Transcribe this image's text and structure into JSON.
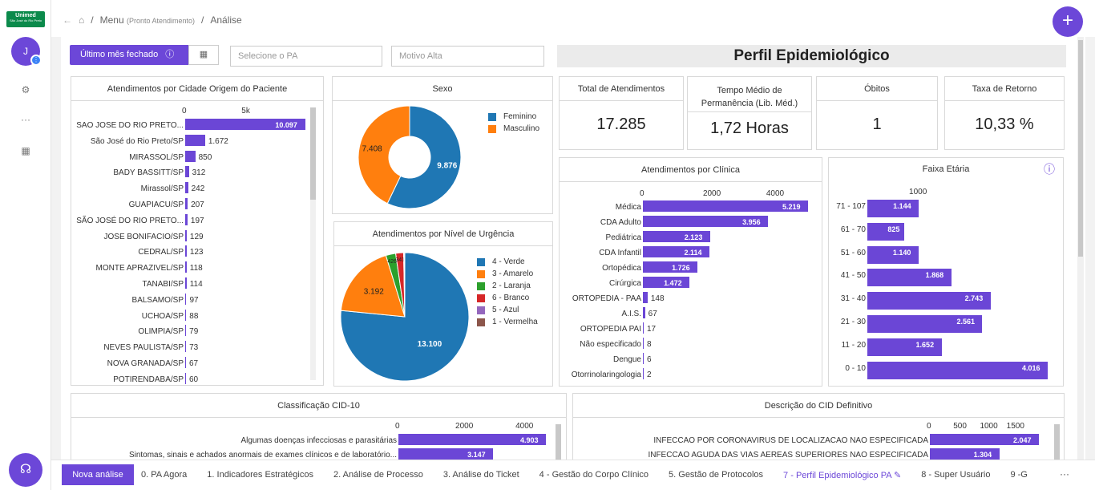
{
  "brand": {
    "logo_text": "Unimed",
    "logo_sub": "São José do Rio Preto",
    "color": "#6c47d8"
  },
  "user": {
    "initial": "J"
  },
  "breadcrumb": {
    "menu": "Menu",
    "menu_sub": "(Pronto Atendimento)",
    "sep": "/",
    "page": "Análise"
  },
  "filters": {
    "period": "Último mês fechado",
    "pa_placeholder": "Selecione o PA",
    "motivo_placeholder": "Motivo Alta"
  },
  "dashboard_title": "Perfil Epidemiológico",
  "kpis": [
    {
      "title": "Total de Atendimentos",
      "value": "17.285"
    },
    {
      "title": "Tempo Médio de Permanência (Lib. Méd.)",
      "value": "1,72 Horas"
    },
    {
      "title": "Óbitos",
      "value": "1"
    },
    {
      "title": "Taxa de Retorno",
      "value": "10,33 %"
    }
  ],
  "cards": {
    "cidade": "Atendimentos por Cidade Origem do Paciente",
    "sexo": "Sexo",
    "urgencia": "Atendimentos por Nível de Urgência",
    "clinica": "Atendimentos por Clínica",
    "faixa": "Faixa Etária",
    "cid10": "Classificação CID-10",
    "cid_def": "Descrição do CID Definitivo"
  },
  "chart_data": [
    {
      "type": "bar",
      "orientation": "horizontal",
      "title": "Atendimentos por Cidade Origem do Paciente",
      "ticks": [
        "0",
        "5k"
      ],
      "xlim": [
        0,
        10097
      ],
      "categories": [
        "SAO JOSE DO RIO PRETO...",
        "São José do Rio Preto/SP",
        "MIRASSOL/SP",
        "BADY BASSITT/SP",
        "Mirassol/SP",
        "GUAPIACU/SP",
        "SÃO JOSÉ DO RIO PRETO...",
        "JOSE BONIFACIO/SP",
        "CEDRAL/SP",
        "MONTE APRAZIVEL/SP",
        "TANABI/SP",
        "BALSAMO/SP",
        "UCHOA/SP",
        "OLIMPIA/SP",
        "NEVES PAULISTA/SP",
        "NOVA GRANADA/SP",
        "POTIRENDABA/SP"
      ],
      "values": [
        10097,
        1672,
        850,
        312,
        242,
        207,
        197,
        129,
        123,
        118,
        114,
        97,
        88,
        79,
        73,
        67,
        60
      ],
      "labels": [
        "10.097",
        "1.672",
        "850",
        "312",
        "242",
        "207",
        "197",
        "129",
        "123",
        "118",
        "114",
        "97",
        "88",
        "79",
        "73",
        "67",
        "60"
      ]
    },
    {
      "type": "pie",
      "title": "Sexo",
      "donut": true,
      "categories": [
        "Feminino",
        "Masculino"
      ],
      "values": [
        9876,
        7408
      ],
      "labels": [
        "9.876",
        "7.408"
      ],
      "colors": [
        "#1f77b4",
        "#ff7f0e"
      ]
    },
    {
      "type": "pie",
      "title": "Atendimentos por Nível de Urgência",
      "categories": [
        "4 - Verde",
        "3 - Amarelo",
        "2 - Laranja",
        "6 - Branco",
        "5 - Azul",
        "1 - Vermelha"
      ],
      "values": [
        13100,
        3192,
        426,
        341,
        40,
        10
      ],
      "labels": [
        "13.100",
        "3.192",
        "426",
        "341",
        "",
        ""
      ],
      "colors": [
        "#1f77b4",
        "#ff7f0e",
        "#2ca02c",
        "#d62728",
        "#9467bd",
        "#8c564b"
      ]
    },
    {
      "type": "bar",
      "orientation": "horizontal",
      "title": "Atendimentos por Clínica",
      "ticks": [
        "0",
        "2000",
        "4000"
      ],
      "xlim": [
        0,
        5219
      ],
      "categories": [
        "Médica",
        "CDA Adulto",
        "Pediátrica",
        "CDA Infantil",
        "Ortopédica",
        "Cirúrgica",
        "ORTOPEDIA - PAA",
        "A.I.S.",
        "ORTOPEDIA PAI",
        "Não especificado",
        "Dengue",
        "Otorrinolaringologia"
      ],
      "values": [
        5219,
        3956,
        2123,
        2114,
        1726,
        1472,
        148,
        67,
        17,
        8,
        6,
        2
      ],
      "labels": [
        "5.219",
        "3.956",
        "2.123",
        "2.114",
        "1.726",
        "1.472",
        "148",
        "67",
        "17",
        "8",
        "6",
        "2"
      ]
    },
    {
      "type": "bar",
      "orientation": "horizontal",
      "title": "Faixa Etária",
      "ticks": [
        "1000"
      ],
      "xlim": [
        0,
        4016
      ],
      "categories": [
        "71 - 107",
        "61 - 70",
        "51 - 60",
        "41 - 50",
        "31 - 40",
        "21 - 30",
        "11 - 20",
        "0 - 10"
      ],
      "values": [
        1144,
        825,
        1140,
        1868,
        2743,
        2561,
        1652,
        4016
      ],
      "labels": [
        "1.144",
        "825",
        "1.140",
        "1.868",
        "2.743",
        "2.561",
        "1.652",
        "4.016"
      ]
    },
    {
      "type": "bar",
      "orientation": "horizontal",
      "title": "Classificação CID-10",
      "ticks": [
        "0",
        "2000",
        "4000"
      ],
      "xlim": [
        0,
        4903
      ],
      "categories": [
        "Algumas doenças infecciosas e parasitárias",
        "Sintomas, sinais e achados anormais de exames clínicos e de laboratório..."
      ],
      "values": [
        4903,
        3147
      ],
      "labels": [
        "4.903",
        "3.147"
      ]
    },
    {
      "type": "bar",
      "orientation": "horizontal",
      "title": "Descrição do CID Definitivo",
      "ticks": [
        "0",
        "500",
        "1000",
        "1500"
      ],
      "xlim": [
        0,
        2047
      ],
      "categories": [
        "INFECCAO POR CORONAVIRUS DE LOCALIZACAO NAO ESPECIFICADA",
        "INFECCAO AGUDA DAS VIAS AEREAS SUPERIORES NAO ESPECIFICADA"
      ],
      "values": [
        2047,
        1304
      ],
      "labels": [
        "2.047",
        "1.304"
      ]
    }
  ],
  "bottom": {
    "new_label": "Nova análise",
    "tabs": [
      "0. PA Agora",
      "1. Indicadores Estratégicos",
      "2. Análise de Processo",
      "3. Análise do Ticket",
      "4 - Gestão do Corpo Clínico",
      "5. Gestão de Protocolos",
      "7 - Perfil Epidemiológico PA",
      "8 - Super Usuário",
      "9 -G"
    ],
    "active_index": 6,
    "more": "···"
  }
}
